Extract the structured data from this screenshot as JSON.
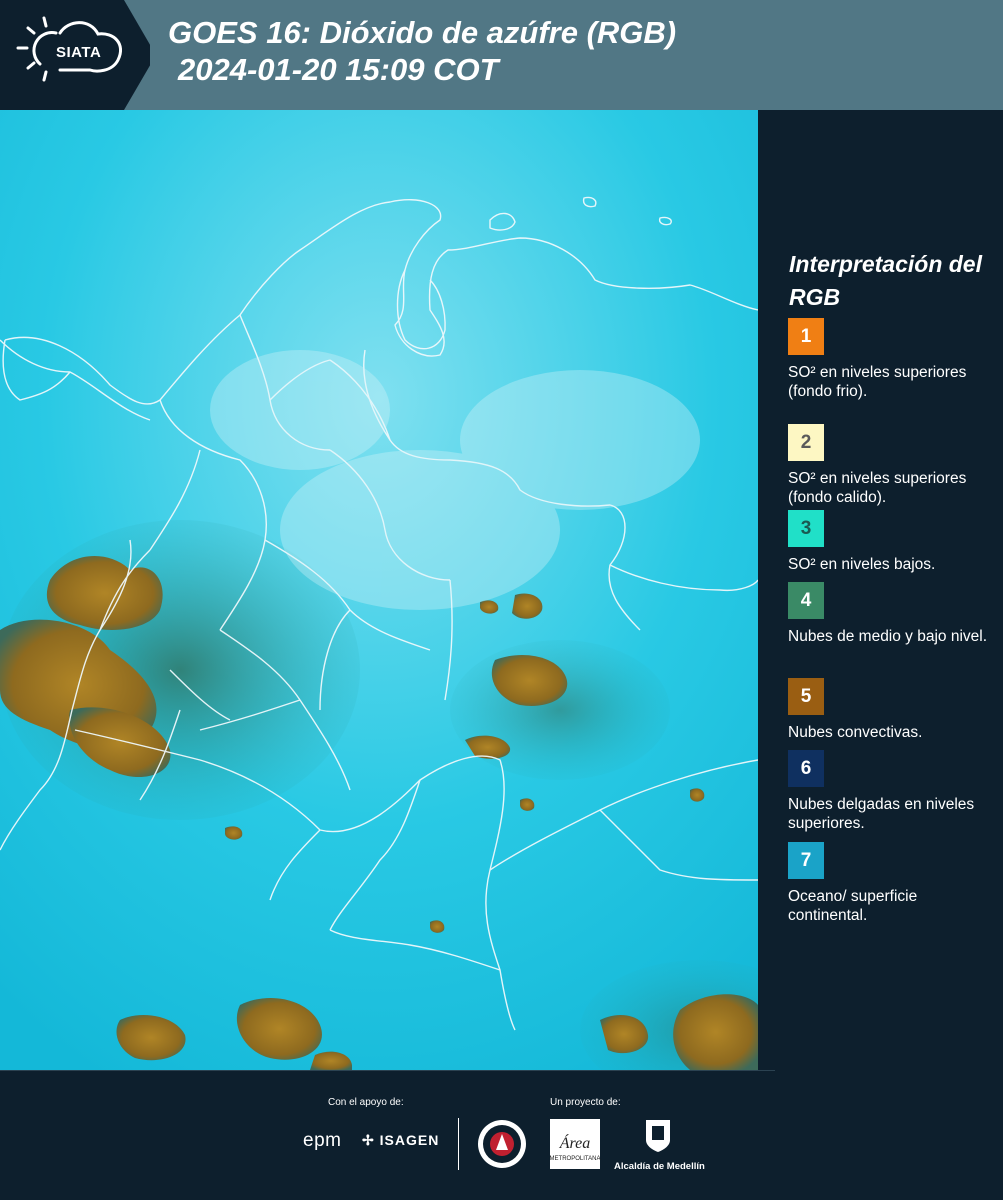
{
  "header": {
    "logo_text": "SIATA",
    "title_line1": "GOES 16: Dióxido de azúfre (RGB)",
    "title_line2": "2024-01-20 15:09 COT"
  },
  "legend": {
    "title": "Interpretación del RGB",
    "items": [
      {
        "number": "1",
        "label": "SO² en niveles superiores (fondo frio).",
        "color": "#f07f14",
        "text_color": "#ffffff"
      },
      {
        "number": "2",
        "label": "SO² en niveles superiores (fondo calido).",
        "color": "#fdf7c3",
        "text_color": "#5a5a5a"
      },
      {
        "number": "3",
        "label": "SO² en niveles bajos.",
        "color": "#20e0c8",
        "text_color": "#1a5a52"
      },
      {
        "number": "4",
        "label": "Nubes de medio y bajo nivel.",
        "color": "#3a8a66",
        "text_color": "#ffffff"
      },
      {
        "number": "5",
        "label": "Nubes convectivas.",
        "color": "#9a5e12",
        "text_color": "#ffffff"
      },
      {
        "number": "6",
        "label": "Nubes delgadas en niveles superiores.",
        "color": "#0f3060",
        "text_color": "#ffffff"
      },
      {
        "number": "7",
        "label": "Oceano/ superficie continental.",
        "color": "#1aa3c8",
        "text_color": "#ffffff"
      }
    ]
  },
  "footer": {
    "support_label": "Con el apoyo de:",
    "project_label": "Un proyecto de:",
    "sponsors": [
      "epm",
      "ISAGEN"
    ],
    "partners": [
      "Área Metropolitana Valle de Aburrá",
      "Alcaldía de Medellín"
    ],
    "area_logo_text": "Área",
    "area_logo_subtext": "METROPOLITANA",
    "alcaldia_label": "Alcaldía de Medellín"
  },
  "map": {
    "ocean_color": "#1fc6e3",
    "land_color": "#22c8e0",
    "cloud_color": "#9a7620",
    "border_color": "#e8f4f8"
  }
}
